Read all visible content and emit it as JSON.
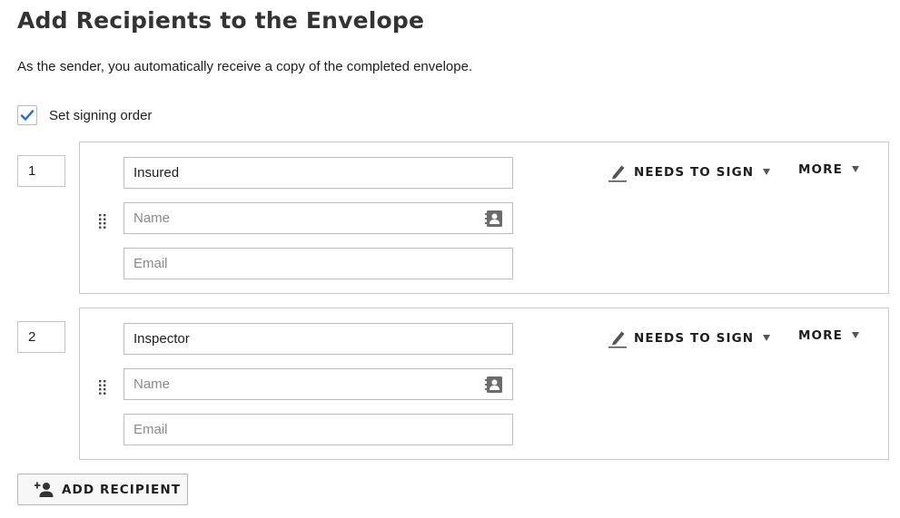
{
  "page": {
    "title": "Add Recipients to the Envelope",
    "subtitle": "As the sender, you automatically receive a copy of the completed envelope."
  },
  "signing_order": {
    "label": "Set signing order",
    "checked": true
  },
  "recipients": [
    {
      "order": "1",
      "role": "Insured",
      "name_placeholder": "Name",
      "email_placeholder": "Email",
      "action_label": "NEEDS TO SIGN",
      "more_label": "MORE"
    },
    {
      "order": "2",
      "role": "Inspector",
      "name_placeholder": "Name",
      "email_placeholder": "Email",
      "action_label": "NEEDS TO SIGN",
      "more_label": "MORE"
    }
  ],
  "add_recipient": {
    "label": "ADD RECIPIENT"
  },
  "colors": {
    "checkmark": "#1a6fd4",
    "icon": "#6b6b6b",
    "text": "#1e1e1e"
  }
}
